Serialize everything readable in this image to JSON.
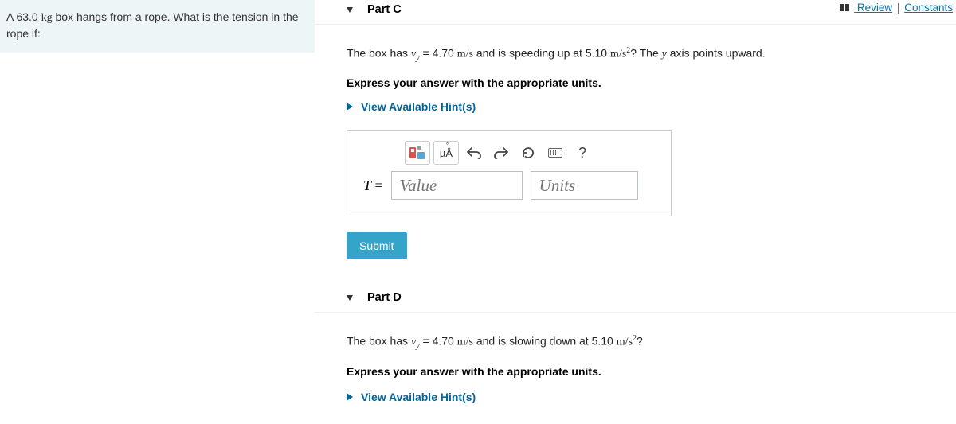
{
  "top_links": {
    "review": "Review",
    "constants": "Constants",
    "sep": "|"
  },
  "sidebar": {
    "problem_pre": "A 63.0 ",
    "problem_unit": "kg",
    "problem_post": " box hangs from a rope. What is the tension in the rope if:"
  },
  "partC": {
    "title": "Part C",
    "prompt_pre": "The box has ",
    "vy": "v",
    "vy_sub": "y",
    "prompt_mid": " = 4.70 ",
    "ms": "m/s",
    "prompt_mid2": " and is speeding up at 5.10 ",
    "ms2": "m/s",
    "prompt_post": "? The ",
    "yaxis": "y",
    "prompt_end": " axis points upward.",
    "instruction": "Express your answer with the appropriate units.",
    "hint": "View Available Hint(s)",
    "toolbar": {
      "units_btn": "µÅ",
      "help": "?"
    },
    "t_label": "T",
    "eq": " = ",
    "value_ph": "Value",
    "units_ph": "Units",
    "submit": "Submit"
  },
  "partD": {
    "title": "Part D",
    "prompt_pre": "The box has ",
    "vy": "v",
    "vy_sub": "y",
    "prompt_mid": " = 4.70 ",
    "ms": "m/s",
    "prompt_mid2": " and is slowing down at 5.10 ",
    "ms2": "m/s",
    "prompt_post": "?",
    "instruction": "Express your answer with the appropriate units.",
    "hint": "View Available Hint(s)"
  }
}
